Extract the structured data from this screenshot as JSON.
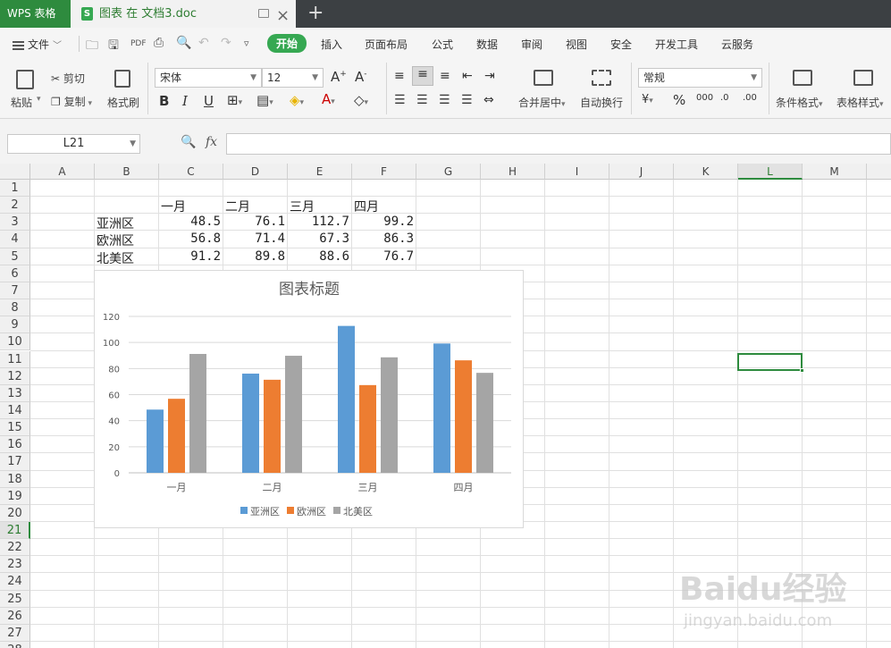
{
  "titlebar": {
    "app_name": "WPS 表格",
    "doc_icon_letter": "S",
    "doc_title": "图表 在 文档3.doc"
  },
  "menu": {
    "file_label": "文件",
    "items": [
      {
        "label": "开始",
        "active": true
      },
      {
        "label": "插入"
      },
      {
        "label": "页面布局"
      },
      {
        "label": "公式"
      },
      {
        "label": "数据"
      },
      {
        "label": "审阅"
      },
      {
        "label": "视图"
      },
      {
        "label": "安全"
      },
      {
        "label": "开发工具"
      },
      {
        "label": "云服务"
      }
    ]
  },
  "ribbon": {
    "paste": "粘贴",
    "cut": "剪切",
    "copy": "复制",
    "format_painter": "格式刷",
    "font_name": "宋体",
    "font_size": "12",
    "number_format": "常规",
    "merge_center": "合并居中",
    "wrap_text": "自动换行",
    "cond_format": "条件格式",
    "table_style": "表格样式"
  },
  "formula_bar": {
    "name_box": "L21",
    "fx": "fx",
    "formula": ""
  },
  "sheet": {
    "columns": [
      "A",
      "B",
      "C",
      "D",
      "E",
      "F",
      "G",
      "H",
      "I",
      "J",
      "K",
      "L",
      "M"
    ],
    "selected_column": "L",
    "selected_row": 21,
    "row_count": 28,
    "header_row": [
      "一月",
      "二月",
      "三月",
      "四月"
    ],
    "rows": [
      {
        "label": "亚洲区",
        "values": [
          "48.5",
          "76.1",
          "112.7",
          "99.2"
        ]
      },
      {
        "label": "欧洲区",
        "values": [
          "56.8",
          "71.4",
          "67.3",
          "86.3"
        ]
      },
      {
        "label": "北美区",
        "values": [
          "91.2",
          "89.8",
          "88.6",
          "76.7"
        ]
      }
    ]
  },
  "chart_data": {
    "type": "bar",
    "title": "图表标题",
    "categories": [
      "一月",
      "二月",
      "三月",
      "四月"
    ],
    "series": [
      {
        "name": "亚洲区",
        "values": [
          48.5,
          76.1,
          112.7,
          99.2
        ],
        "color": "#5b9bd5"
      },
      {
        "name": "欧洲区",
        "values": [
          56.8,
          71.4,
          67.3,
          86.3
        ],
        "color": "#ed7d31"
      },
      {
        "name": "北美区",
        "values": [
          91.2,
          89.8,
          88.6,
          76.7
        ],
        "color": "#a5a5a5"
      }
    ],
    "ylim": [
      0,
      120
    ],
    "yticks": [
      0,
      20,
      40,
      60,
      80,
      100,
      120
    ],
    "grid": true,
    "legend": "bottom"
  },
  "watermark": {
    "brand": "Baidu经验",
    "url": "jingyan.baidu.com"
  }
}
